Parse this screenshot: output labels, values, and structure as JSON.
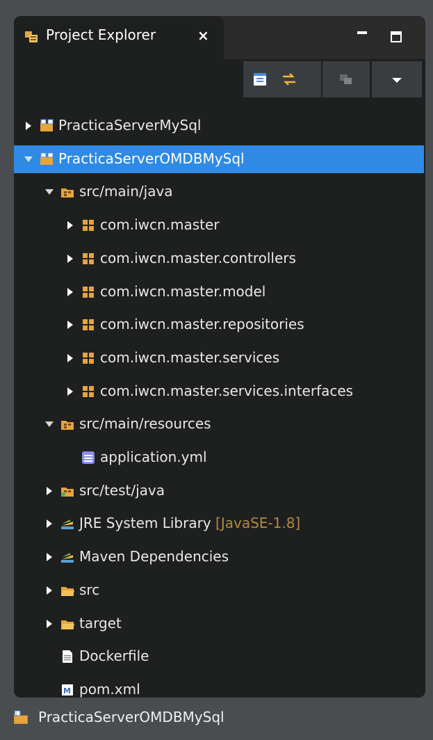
{
  "view": {
    "tab_title": "Project Explorer",
    "close_glyph": "×"
  },
  "tree": [
    {
      "label": "PracticaServerMySql",
      "icon": "project-icon",
      "arrow": "collapsed",
      "depth": 0
    },
    {
      "label": "PracticaServerOMDBMySql",
      "icon": "project-icon",
      "arrow": "expanded",
      "depth": 0,
      "selected": true
    },
    {
      "label": "src/main/java",
      "icon": "source-folder-icon",
      "arrow": "expanded",
      "depth": 1
    },
    {
      "label": "com.iwcn.master",
      "icon": "package-icon",
      "arrow": "collapsed",
      "depth": 2
    },
    {
      "label": "com.iwcn.master.controllers",
      "icon": "package-icon",
      "arrow": "collapsed",
      "depth": 2
    },
    {
      "label": "com.iwcn.master.model",
      "icon": "package-icon",
      "arrow": "collapsed",
      "depth": 2
    },
    {
      "label": "com.iwcn.master.repositories",
      "icon": "package-icon",
      "arrow": "collapsed",
      "depth": 2
    },
    {
      "label": "com.iwcn.master.services",
      "icon": "package-icon",
      "arrow": "collapsed",
      "depth": 2
    },
    {
      "label": "com.iwcn.master.services.interfaces",
      "icon": "package-icon",
      "arrow": "collapsed",
      "depth": 2
    },
    {
      "label": "src/main/resources",
      "icon": "source-folder-icon",
      "arrow": "expanded",
      "depth": 1
    },
    {
      "label": "application.yml",
      "icon": "text-file-icon",
      "arrow": "none",
      "depth": 2
    },
    {
      "label": "src/test/java",
      "icon": "test-source-folder-icon",
      "arrow": "collapsed",
      "depth": 1
    },
    {
      "label": "JRE System Library",
      "decoration": "[JavaSE-1.8]",
      "icon": "library-icon",
      "arrow": "collapsed",
      "depth": 1
    },
    {
      "label": "Maven Dependencies",
      "icon": "library-icon",
      "arrow": "collapsed",
      "depth": 1
    },
    {
      "label": "src",
      "icon": "folder-icon",
      "arrow": "collapsed",
      "depth": 1
    },
    {
      "label": "target",
      "icon": "folder-icon",
      "arrow": "collapsed",
      "depth": 1
    },
    {
      "label": "Dockerfile",
      "icon": "file-icon",
      "arrow": "none",
      "depth": 1
    },
    {
      "label": "pom.xml",
      "icon": "maven-file-icon",
      "arrow": "none",
      "depth": 1
    }
  ],
  "status": {
    "label": "PracticaServerOMDBMySql"
  },
  "colors": {
    "selection": "#2f8ae4",
    "decoration": "#b38a3e",
    "background": "#1e1f1f"
  }
}
